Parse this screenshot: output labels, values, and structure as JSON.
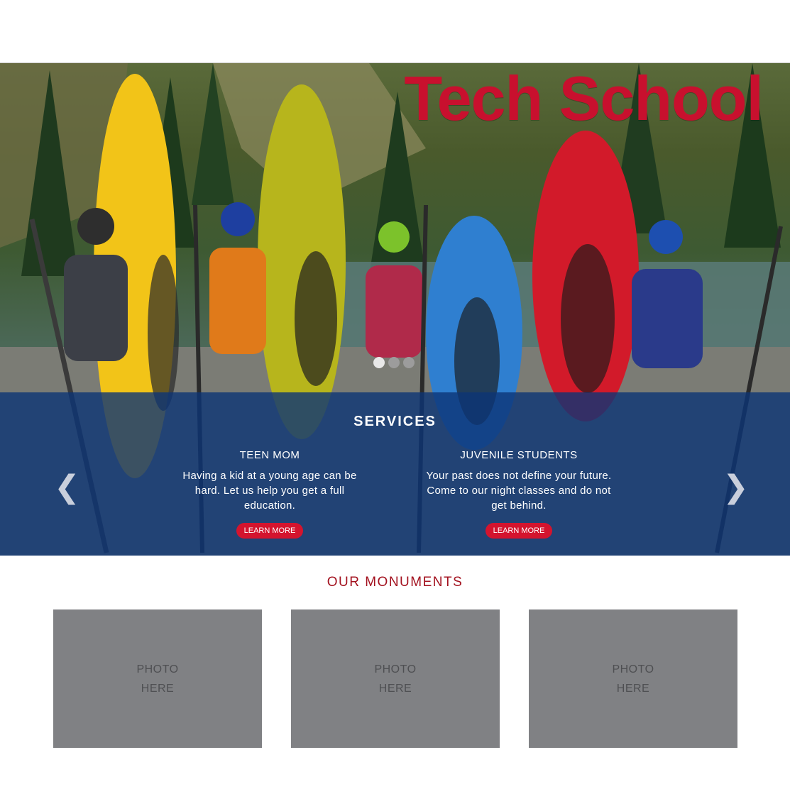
{
  "hero": {
    "brand_title": "Tech School",
    "carousel_dots": 3,
    "active_dot": 1
  },
  "services": {
    "title": "SERVICES",
    "items": [
      {
        "heading": "TEEN MOM",
        "body": "Having a kid at a young age can be hard. Let us help you get a full education.",
        "button": "LEARN MORE"
      },
      {
        "heading": "JUVENILE STUDENTS",
        "body": "Your past does not define your future. Come to our night classes and do not get behind.",
        "button": "LEARN MORE"
      }
    ],
    "prev_icon": "chevron-left-icon",
    "next_icon": "chevron-right-icon"
  },
  "monuments": {
    "title": "OUR MONUMENTS",
    "photos": [
      {
        "line1": "PHOTO",
        "line2": "HERE"
      },
      {
        "line1": "PHOTO",
        "line2": "HERE"
      },
      {
        "line1": "PHOTO",
        "line2": "HERE"
      }
    ]
  },
  "colors": {
    "brand_red": "#c8102e",
    "services_blue": "#0c3576",
    "button_red": "#d4142e",
    "monuments_red": "#a3121f",
    "photo_gray": "#808184"
  }
}
